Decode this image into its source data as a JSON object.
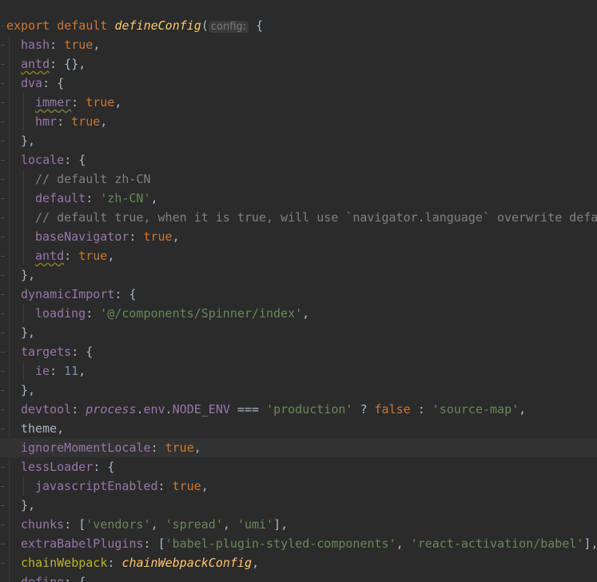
{
  "editor": {
    "colors": {
      "background": "#2b2b2b",
      "keyword": "#cc7832",
      "property": "#9876aa",
      "string": "#6a8759",
      "number": "#6897bb",
      "comment": "#808080",
      "function": "#ffc66d"
    },
    "lines": [
      {
        "indent": 0,
        "tokens": [
          {
            "t": "export default ",
            "c": "kw"
          },
          {
            "t": "defineConfig",
            "c": "fn"
          },
          {
            "t": "(",
            "c": "plain"
          },
          {
            "t": "config:",
            "c": "hint"
          },
          {
            "t": " {",
            "c": "plain"
          }
        ]
      },
      {
        "indent": 1,
        "tokens": [
          {
            "t": "hash",
            "c": "prop"
          },
          {
            "t": ": ",
            "c": "plain"
          },
          {
            "t": "true",
            "c": "kw"
          },
          {
            "t": ",",
            "c": "plain"
          }
        ]
      },
      {
        "indent": 1,
        "tokens": [
          {
            "t": "antd",
            "c": "prop warn"
          },
          {
            "t": ": {},",
            "c": "plain"
          }
        ]
      },
      {
        "indent": 1,
        "tokens": [
          {
            "t": "dva",
            "c": "prop"
          },
          {
            "t": ": {",
            "c": "plain"
          }
        ]
      },
      {
        "indent": 2,
        "tokens": [
          {
            "t": "immer",
            "c": "prop warn"
          },
          {
            "t": ": ",
            "c": "plain"
          },
          {
            "t": "true",
            "c": "kw"
          },
          {
            "t": ",",
            "c": "plain"
          }
        ]
      },
      {
        "indent": 2,
        "tokens": [
          {
            "t": "hmr",
            "c": "prop"
          },
          {
            "t": ": ",
            "c": "plain"
          },
          {
            "t": "true",
            "c": "kw"
          },
          {
            "t": ",",
            "c": "plain"
          }
        ]
      },
      {
        "indent": 1,
        "tokens": [
          {
            "t": "},",
            "c": "plain"
          }
        ]
      },
      {
        "indent": 1,
        "tokens": [
          {
            "t": "locale",
            "c": "prop"
          },
          {
            "t": ": {",
            "c": "plain"
          }
        ]
      },
      {
        "indent": 2,
        "tokens": [
          {
            "t": "// default zh-CN",
            "c": "cmt"
          }
        ]
      },
      {
        "indent": 2,
        "tokens": [
          {
            "t": "default",
            "c": "prop"
          },
          {
            "t": ": ",
            "c": "plain"
          },
          {
            "t": "'zh-CN'",
            "c": "str"
          },
          {
            "t": ",",
            "c": "plain"
          }
        ]
      },
      {
        "indent": 2,
        "tokens": [
          {
            "t": "// default true, when it is true, will use `navigator.language` overwrite default",
            "c": "cmt"
          }
        ]
      },
      {
        "indent": 2,
        "tokens": [
          {
            "t": "baseNavigator",
            "c": "prop"
          },
          {
            "t": ": ",
            "c": "plain"
          },
          {
            "t": "true",
            "c": "kw"
          },
          {
            "t": ",",
            "c": "plain"
          }
        ]
      },
      {
        "indent": 2,
        "tokens": [
          {
            "t": "antd",
            "c": "prop warn"
          },
          {
            "t": ": ",
            "c": "plain"
          },
          {
            "t": "true",
            "c": "kw"
          },
          {
            "t": ",",
            "c": "plain"
          }
        ]
      },
      {
        "indent": 1,
        "tokens": [
          {
            "t": "},",
            "c": "plain"
          }
        ]
      },
      {
        "indent": 1,
        "tokens": [
          {
            "t": "dynamicImport",
            "c": "prop"
          },
          {
            "t": ": {",
            "c": "plain"
          }
        ]
      },
      {
        "indent": 2,
        "tokens": [
          {
            "t": "loading",
            "c": "prop"
          },
          {
            "t": ": ",
            "c": "plain"
          },
          {
            "t": "'@/components/Spinner/index'",
            "c": "str"
          },
          {
            "t": ",",
            "c": "plain"
          }
        ]
      },
      {
        "indent": 1,
        "tokens": [
          {
            "t": "},",
            "c": "plain"
          }
        ]
      },
      {
        "indent": 1,
        "tokens": [
          {
            "t": "targets",
            "c": "prop"
          },
          {
            "t": ": {",
            "c": "plain"
          }
        ]
      },
      {
        "indent": 2,
        "tokens": [
          {
            "t": "ie",
            "c": "prop"
          },
          {
            "t": ": ",
            "c": "plain"
          },
          {
            "t": "11",
            "c": "num"
          },
          {
            "t": ",",
            "c": "plain"
          }
        ]
      },
      {
        "indent": 1,
        "tokens": [
          {
            "t": "},",
            "c": "plain"
          }
        ]
      },
      {
        "indent": 1,
        "tokens": [
          {
            "t": "devtool",
            "c": "prop"
          },
          {
            "t": ": ",
            "c": "plain"
          },
          {
            "t": "process",
            "c": "glob"
          },
          {
            "t": ".",
            "c": "plain"
          },
          {
            "t": "env",
            "c": "prop"
          },
          {
            "t": ".",
            "c": "plain"
          },
          {
            "t": "NODE_ENV",
            "c": "prop"
          },
          {
            "t": " === ",
            "c": "plain"
          },
          {
            "t": "'production'",
            "c": "str"
          },
          {
            "t": " ? ",
            "c": "plain"
          },
          {
            "t": "false",
            "c": "kw"
          },
          {
            "t": " : ",
            "c": "plain"
          },
          {
            "t": "'source-map'",
            "c": "str"
          },
          {
            "t": ",",
            "c": "plain"
          }
        ]
      },
      {
        "indent": 1,
        "tokens": [
          {
            "t": "theme,",
            "c": "plain"
          }
        ]
      },
      {
        "indent": 1,
        "highlight": true,
        "tokens": [
          {
            "t": "ignoreMomentLocale",
            "c": "prop"
          },
          {
            "t": ": ",
            "c": "plain"
          },
          {
            "t": "true",
            "c": "kw"
          },
          {
            "t": ",",
            "c": "plain"
          }
        ]
      },
      {
        "indent": 1,
        "tokens": [
          {
            "t": "lessLoader",
            "c": "prop"
          },
          {
            "t": ": {",
            "c": "plain"
          }
        ]
      },
      {
        "indent": 2,
        "tokens": [
          {
            "t": "javascriptEnabled",
            "c": "prop"
          },
          {
            "t": ": ",
            "c": "plain"
          },
          {
            "t": "true",
            "c": "kw"
          },
          {
            "t": ",",
            "c": "plain"
          }
        ]
      },
      {
        "indent": 1,
        "tokens": [
          {
            "t": "},",
            "c": "plain"
          }
        ]
      },
      {
        "indent": 1,
        "tokens": [
          {
            "t": "chunks",
            "c": "prop"
          },
          {
            "t": ": [",
            "c": "plain"
          },
          {
            "t": "'vendors'",
            "c": "str"
          },
          {
            "t": ", ",
            "c": "plain"
          },
          {
            "t": "'spread'",
            "c": "str"
          },
          {
            "t": ", ",
            "c": "plain"
          },
          {
            "t": "'umi'",
            "c": "str"
          },
          {
            "t": "],",
            "c": "plain"
          }
        ]
      },
      {
        "indent": 1,
        "tokens": [
          {
            "t": "extraBabelPlugins",
            "c": "prop"
          },
          {
            "t": ": [",
            "c": "plain"
          },
          {
            "t": "'babel-plugin-styled-components'",
            "c": "str"
          },
          {
            "t": ", ",
            "c": "plain"
          },
          {
            "t": "'react-activation/babel'",
            "c": "str"
          },
          {
            "t": "],",
            "c": "plain"
          }
        ]
      },
      {
        "indent": 1,
        "tokens": [
          {
            "t": "chainWebpack",
            "c": "ann"
          },
          {
            "t": ": ",
            "c": "plain"
          },
          {
            "t": "chainWebpackConfig",
            "c": "fn"
          },
          {
            "t": ",",
            "c": "plain"
          }
        ]
      },
      {
        "indent": 1,
        "tokens": [
          {
            "t": "define",
            "c": "prop"
          },
          {
            "t": ": {",
            "c": "plain"
          }
        ]
      }
    ]
  }
}
